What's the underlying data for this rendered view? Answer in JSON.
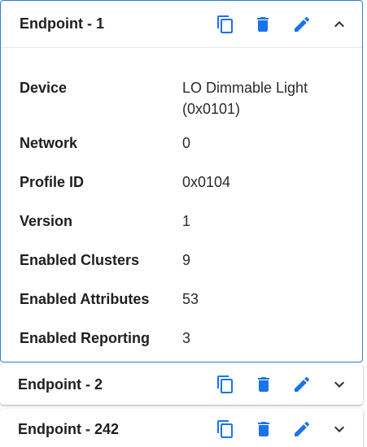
{
  "colors": {
    "accent": "#1a73e8",
    "icon_dark": "#2d2d2d",
    "expanded_border": "#2f7fd6"
  },
  "endpoints": [
    {
      "title": "Endpoint - 1",
      "expanded": true,
      "details": [
        {
          "label": "Device",
          "value": "LO Dimmable Light (0x0101)"
        },
        {
          "label": "Network",
          "value": "0"
        },
        {
          "label": "Profile ID",
          "value": "0x0104"
        },
        {
          "label": "Version",
          "value": "1"
        },
        {
          "label": "Enabled Clusters",
          "value": "9"
        },
        {
          "label": "Enabled Attributes",
          "value": "53"
        },
        {
          "label": "Enabled Reporting",
          "value": "3"
        }
      ],
      "icons": [
        "copy-icon",
        "delete-icon",
        "edit-icon",
        "chevron-up-icon"
      ]
    },
    {
      "title": "Endpoint - 2",
      "expanded": false,
      "icons": [
        "copy-icon",
        "delete-icon",
        "edit-icon",
        "chevron-down-icon"
      ]
    },
    {
      "title": "Endpoint - 242",
      "expanded": false,
      "icons": [
        "copy-icon",
        "delete-icon",
        "edit-icon",
        "chevron-down-icon"
      ]
    }
  ]
}
